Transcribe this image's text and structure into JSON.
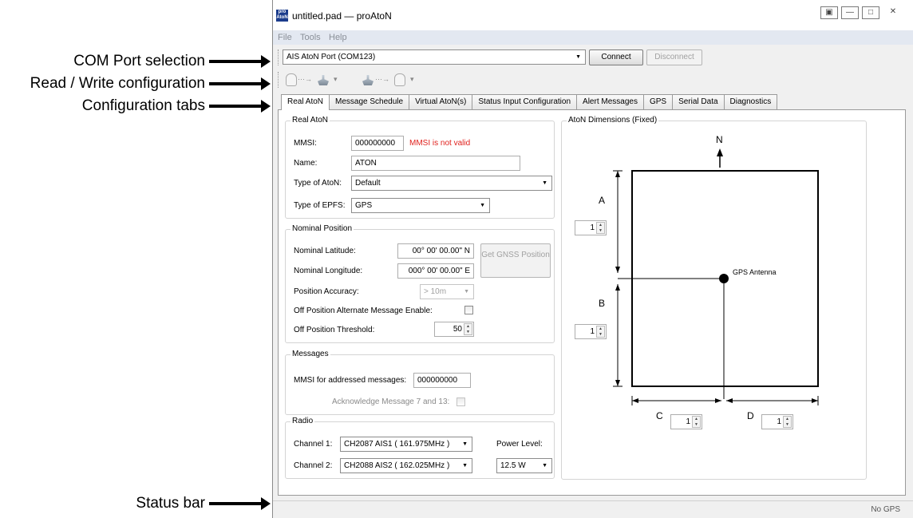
{
  "callouts": {
    "com_port": "COM Port selection",
    "read_write": "Read / Write configuration",
    "config_tabs": "Configuration tabs",
    "status_bar": "Status bar"
  },
  "window": {
    "icon_text": "pro AtoN",
    "title": "untitled.pad — proAtoN",
    "controls": [
      "▣",
      "—",
      "□",
      "✕"
    ]
  },
  "menu": [
    "File",
    "Tools",
    "Help"
  ],
  "port": {
    "value": "AIS AtoN Port (COM123)",
    "connect": "Connect",
    "disconnect": "Disconnect"
  },
  "toolbar": {
    "arrow1": "···→",
    "arrow2": "···→",
    "dropdown": "▾"
  },
  "tabs": [
    "Real AtoN",
    "Message Schedule",
    "Virtual AtoN(s)",
    "Status Input Configuration",
    "Alert Messages",
    "GPS",
    "Serial Data",
    "Diagnostics"
  ],
  "real_aton": {
    "group_title": "Real AtoN",
    "mmsi_label": "MMSI:",
    "mmsi_value": "000000000",
    "mmsi_error": "MMSI is not valid",
    "name_label": "Name:",
    "name_value": "ATON",
    "type_label": "Type of AtoN:",
    "type_value": "Default",
    "epfs_label": "Type of EPFS:",
    "epfs_value": "GPS"
  },
  "nominal": {
    "group_title": "Nominal Position",
    "lat_label": "Nominal Latitude:",
    "lat_value": "00° 00' 00.00\" N",
    "lon_label": "Nominal Longitude:",
    "lon_value": "000° 00' 00.00\" E",
    "gnss_button": "Get GNSS Position",
    "accuracy_label": "Position Accuracy:",
    "accuracy_value": "> 10m",
    "offpos_label": "Off Position Alternate Message Enable:",
    "threshold_label": "Off Position Threshold:",
    "threshold_value": "50"
  },
  "messages": {
    "group_title": "Messages",
    "addr_label": "MMSI for addressed messages:",
    "addr_value": "000000000",
    "ack_label": "Acknowledge Message 7 and 13:"
  },
  "radio": {
    "group_title": "Radio",
    "ch1_label": "Channel 1:",
    "ch1_value": "CH2087 AIS1 ( 161.975MHz )",
    "ch2_label": "Channel 2:",
    "ch2_value": "CH2088 AIS2 ( 162.025MHz )",
    "power_label": "Power Level:",
    "power_value": "12.5 W"
  },
  "dimensions": {
    "group_title": "AtoN Dimensions (Fixed)",
    "north": "N",
    "a": "A",
    "b": "B",
    "c": "C",
    "d": "D",
    "a_value": "1",
    "b_value": "1",
    "c_value": "1",
    "d_value": "1",
    "antenna": "GPS Antenna"
  },
  "status": {
    "gps": "No GPS"
  }
}
